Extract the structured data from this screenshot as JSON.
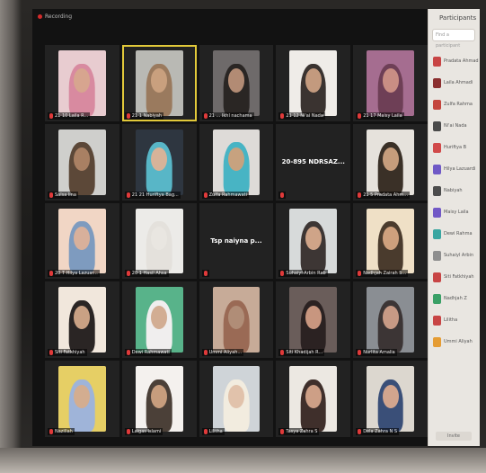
{
  "window": {
    "title": "Recording"
  },
  "tiles": [
    {
      "name": "21 10 Laila R...",
      "kind": "person",
      "bg": "#e8ccd0",
      "skin": "#d7a58f",
      "cover": "#d88aa0"
    },
    {
      "name": "21 1 Nabiyah",
      "kind": "person",
      "bg": "#b9b9b4",
      "skin": "#c9a07e",
      "cover": "#9a7a5e",
      "active": true
    },
    {
      "name": "21 ... Ikhl nachama",
      "kind": "person",
      "bg": "#6e6a6a",
      "skin": "#b28b74",
      "cover": "#2a2624"
    },
    {
      "name": "21 12 Ni'ai Nada",
      "kind": "person",
      "bg": "#efece8",
      "skin": "#c39a7e",
      "cover": "#3a3330"
    },
    {
      "name": "21 17 Maisy Laila",
      "kind": "person",
      "bg": "#a56d90",
      "skin": "#c98e84",
      "cover": "#6e3f56"
    },
    {
      "name": "Salsa lina",
      "kind": "person",
      "bg": "#cfcfcc",
      "skin": "#a98063",
      "cover": "#5c4838"
    },
    {
      "name": "21 21 Huriftya Bag...",
      "kind": "person",
      "bg": "#2e3640",
      "skin": "#d7b399",
      "cover": "#58b6c7"
    },
    {
      "name": "Zulfa Rahmawati",
      "kind": "person",
      "bg": "#dedbd8",
      "skin": "#c7a27f",
      "cover": "#48b4c4"
    },
    {
      "name": "",
      "kind": "text",
      "text": "20-895 NDRSAZ..."
    },
    {
      "name": "21 5 Pradata Ahm...",
      "kind": "person",
      "bg": "#e6e2dc",
      "skin": "#c69d7c",
      "cover": "#3a3027"
    },
    {
      "name": "20 T Hilya Lazuar...",
      "kind": "person",
      "bg": "#f1d6c5",
      "skin": "#d8b09b",
      "cover": "#7e9bbf"
    },
    {
      "name": "20 1 Hasil Ahsa",
      "kind": "person",
      "bg": "#ecebe8",
      "skin": "#e9e6e1",
      "cover": "#e4e1dc"
    },
    {
      "name": "",
      "kind": "text",
      "text": "Tsp naiyna p..."
    },
    {
      "name": "Suhaiyl Arbin Rab",
      "kind": "person",
      "bg": "#d7dada",
      "skin": "#cfa488",
      "cover": "#3d3634"
    },
    {
      "name": "Nadhjah Zairah S...",
      "kind": "person",
      "bg": "#efe0c6",
      "skin": "#cea07d",
      "cover": "#4a3b2d"
    },
    {
      "name": "Siti Fatkhiyah",
      "kind": "person",
      "bg": "#f1e7dc",
      "skin": "#c9a184",
      "cover": "#2a2524"
    },
    {
      "name": "Dewi Rahmawati",
      "kind": "person",
      "bg": "#58b38a",
      "skin": "#d2ad93",
      "cover": "#f0eeee"
    },
    {
      "name": "Ummi Aliyah...",
      "kind": "person",
      "bg": "#c7ab98",
      "skin": "#b08d77",
      "cover": "#9a6a55"
    },
    {
      "name": "Siti Khadijah R...",
      "kind": "person",
      "bg": "#6a5d5a",
      "skin": "#c8967f",
      "cover": "#2b2222"
    },
    {
      "name": "Nurlita Amalia",
      "kind": "person",
      "bg": "#8a8e93",
      "skin": "#c79a85",
      "cover": "#3c3535"
    },
    {
      "name": "Nazillah",
      "kind": "person",
      "bg": "#e6cf65",
      "skin": "#d3ad90",
      "cover": "#9fb4d9"
    },
    {
      "name": "Laigas Islami",
      "kind": "person",
      "bg": "#f4f1ee",
      "skin": "#c79d7d",
      "cover": "#4b4038"
    },
    {
      "name": "Lilitha",
      "kind": "person",
      "bg": "#cfd4d8",
      "skin": "#e1c2ab",
      "cover": "#f2ecdf"
    },
    {
      "name": "Tasya Zahra S",
      "kind": "person",
      "bg": "#ece8e2",
      "skin": "#cd9f86",
      "cover": "#3f2f2b"
    },
    {
      "name": "Dela Zahra N S",
      "kind": "person",
      "bg": "#dcd7cf",
      "skin": "#d2a58e",
      "cover": "#3a4f78"
    }
  ],
  "panel": {
    "title": "Participants",
    "search_placeholder": "Find a participant",
    "items": [
      {
        "name": "Pradata Ahmad",
        "color": "#c84545"
      },
      {
        "name": "Laila Ahmadi",
        "color": "#8b2f2f"
      },
      {
        "name": "Zulfa Rahma",
        "color": "#c4453d"
      },
      {
        "name": "Ni'ai Nada",
        "color": "#4a4a4a"
      },
      {
        "name": "Huriftya B",
        "color": "#d14a4a"
      },
      {
        "name": "Hilya Lazuardi",
        "color": "#6f59c6"
      },
      {
        "name": "Nabiyah",
        "color": "#4c4c4c"
      },
      {
        "name": "Maisy Laila",
        "color": "#7259c6"
      },
      {
        "name": "Dewi Rahma",
        "color": "#3aa6a1"
      },
      {
        "name": "Suhaiyl Arbin",
        "color": "#8e8e8e"
      },
      {
        "name": "Siti Fatkhiyah",
        "color": "#c84545"
      },
      {
        "name": "Nadhjah Z",
        "color": "#3aa066"
      },
      {
        "name": "Lilitha",
        "color": "#c84545"
      },
      {
        "name": "Ummi Aliyah",
        "color": "#e59c33"
      }
    ],
    "button": "Invite"
  }
}
